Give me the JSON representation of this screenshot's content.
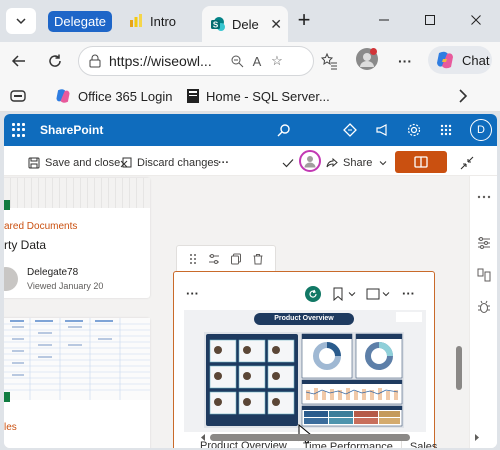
{
  "browser": {
    "tab_group_label": "Delegate",
    "tabs": [
      {
        "label": "Intro",
        "favicon": "powerbi-icon"
      },
      {
        "label": "Dele",
        "favicon": "sharepoint-icon",
        "active": true
      }
    ],
    "address": "https://wiseowl...",
    "chat_label": "Chat",
    "favorites": [
      {
        "label": "Office 365 Login",
        "icon": "copilot-icon"
      },
      {
        "label": "Home - SQL Server...",
        "icon": "document-icon"
      }
    ]
  },
  "sharepoint": {
    "app_title": "SharePoint",
    "user_initial": "D",
    "commands": {
      "save_close": "Save and close",
      "discard": "Discard changes",
      "more": "···",
      "share": "Share"
    }
  },
  "left_cards": {
    "card1": {
      "shared_label": "ared Documents",
      "title": "rty Data",
      "author": "Delegate78",
      "viewed": "Viewed January 20"
    },
    "card2": {
      "shared_label": "les"
    }
  },
  "report": {
    "title": "Product Overview",
    "tabs": [
      "Product Overview",
      "Time Performance",
      "Sales"
    ],
    "active_tab": "Product Overview"
  },
  "colors": {
    "sharepoint_blue": "#0f6cbd",
    "publish_orange": "#ca5010",
    "webpart_border": "#c96a2a",
    "report_teal": "#117865",
    "group_chip": "#1e66c8"
  }
}
